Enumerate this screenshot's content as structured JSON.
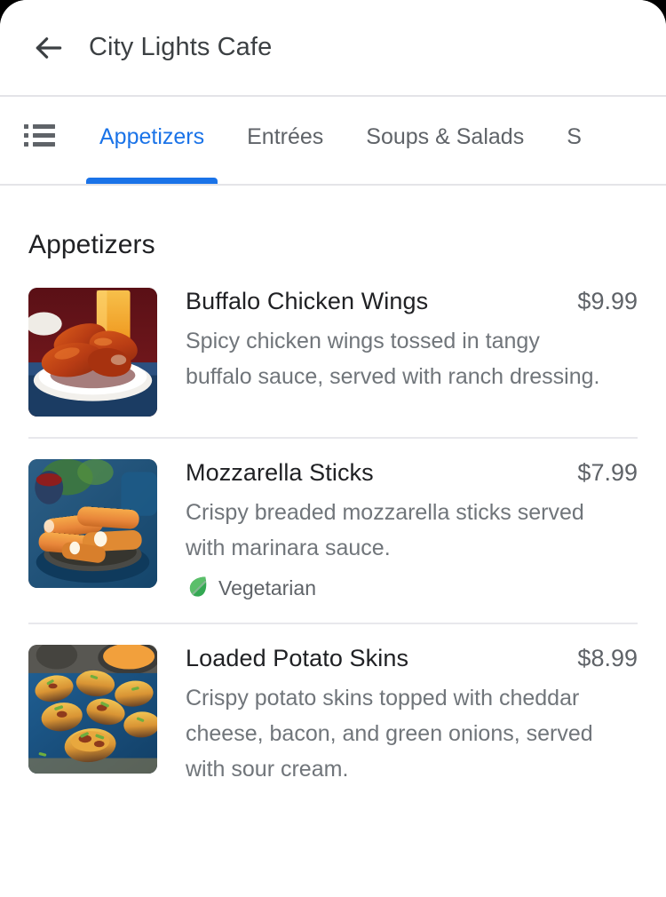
{
  "app_bar": {
    "back_icon": "arrow-left-icon",
    "title": "City Lights Cafe"
  },
  "tab_bar": {
    "list_icon": "list-view-icon",
    "active_tab": "Appetizers",
    "accent_color": "#1a73e8",
    "tabs": [
      {
        "label": "Appetizers",
        "active": true
      },
      {
        "label": "Entrées",
        "active": false
      },
      {
        "label": "Soups & Salads",
        "active": false
      },
      {
        "label": "S",
        "active": false
      }
    ]
  },
  "menu": {
    "section_heading": "Appetizers",
    "items": [
      {
        "name": "Buffalo Chicken Wings",
        "price": "$9.99",
        "description": "Spicy chicken wings tossed in tangy buffalo sauce, served with ranch dressing.",
        "image": "buffalo-chicken-wings-photo",
        "tags": []
      },
      {
        "name": "Mozzarella Sticks",
        "price": "$7.99",
        "description": "Crispy breaded mozzarella sticks served with marinara sauce.",
        "image": "mozzarella-sticks-photo",
        "tags": [
          {
            "label": "Vegetarian",
            "icon": "leaf-icon",
            "color": "#34a853"
          }
        ]
      },
      {
        "name": "Loaded Potato Skins",
        "price": "$8.99",
        "description": "Crispy potato skins topped with cheddar cheese, bacon, and green onions, served with sour cream.",
        "image": "loaded-potato-skins-photo",
        "tags": []
      }
    ]
  }
}
